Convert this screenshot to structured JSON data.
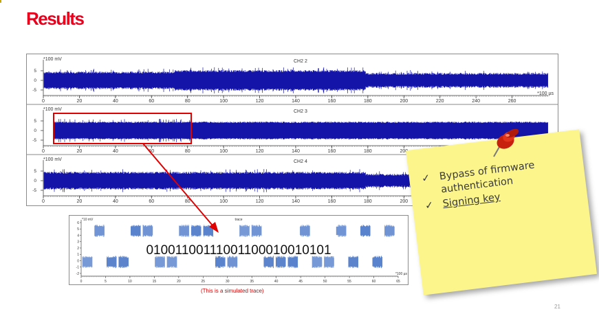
{
  "slide": {
    "title": "Results",
    "caption": "(This is a simulated trace)",
    "page_number": "21"
  },
  "scope": {
    "channels": [
      {
        "name": "CH2 2",
        "unit": "*100 mV",
        "x_unit": "*100 µs"
      },
      {
        "name": "CH2 3",
        "unit": "*100 mV",
        "x_unit": "*100 µs"
      },
      {
        "name": "CH2 4",
        "unit": "*100 mV",
        "x_unit": ""
      }
    ],
    "y_ticks": [
      "5",
      "0",
      "-5"
    ],
    "x_ticks": [
      "0",
      "20",
      "40",
      "60",
      "80",
      "100",
      "120",
      "140",
      "160",
      "180",
      "200",
      "220",
      "240",
      "260"
    ]
  },
  "trace": {
    "name": "trace",
    "unit": "*10 mV",
    "x_unit": "*100 µs",
    "bits": "01001100111001100010010101",
    "y_ticks": [
      "6",
      "5",
      "4",
      "3",
      "2",
      "1",
      "0",
      "-1",
      "-2"
    ],
    "x_ticks": [
      "0",
      "5",
      "10",
      "15",
      "20",
      "25",
      "30",
      "35",
      "40",
      "45",
      "50",
      "55",
      "60",
      "65"
    ]
  },
  "note": {
    "items": [
      {
        "text": "Bypass of firmware authentication",
        "underlined": false
      },
      {
        "text": "Signing key",
        "underlined": true
      }
    ],
    "check_glyph": "✓",
    "pin_icon": "push-pin-icon"
  },
  "colors": {
    "title": "#e8001c",
    "signal": "#1414a8",
    "highlight": "#e00000",
    "note": "#fbf58c"
  }
}
